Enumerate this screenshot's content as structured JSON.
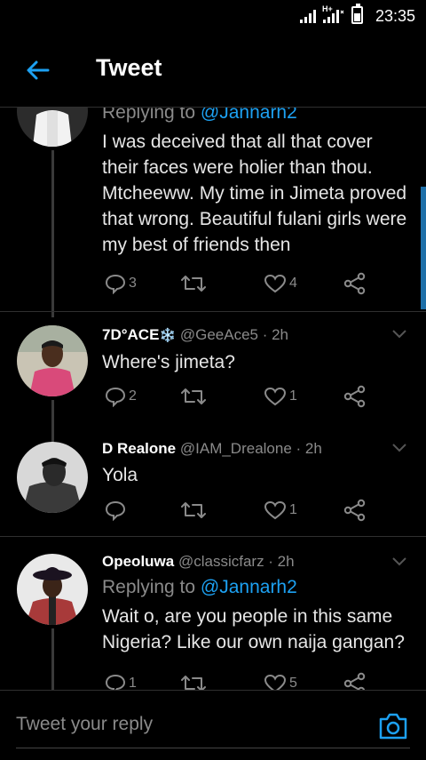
{
  "status_bar": {
    "time": "23:35",
    "network": "H+"
  },
  "header": {
    "title": "Tweet"
  },
  "tweets": [
    {
      "replying_label": "Replying to ",
      "replying_to": "@Jannarh2",
      "text": "I was deceived that all that cover their faces were holier than thou. Mtcheeww. My time in Jimeta proved that wrong. Beautiful fulani girls were my best of friends then",
      "replies": "3",
      "retweets": "",
      "likes": "4"
    },
    {
      "name": "7D°ACE",
      "name_emoji": "❄️",
      "handle": "@GeeAce5 · 2h",
      "text": "Where's jimeta?",
      "replies": "2",
      "retweets": "",
      "likes": "1"
    },
    {
      "name": "D Realone",
      "handle": "@IAM_Drealone · 2h",
      "text": "Yola",
      "replies": "",
      "retweets": "",
      "likes": "1"
    },
    {
      "name": "Opeoluwa",
      "handle": "@classicfarz · 2h",
      "replying_label": "Replying to ",
      "replying_to": "@Jannarh2",
      "text": "Wait o, are you people in this same Nigeria? Like our own naija gangan?",
      "replies": "1",
      "retweets": "",
      "likes": "5"
    }
  ],
  "reply_bar": {
    "placeholder": "Tweet your reply"
  },
  "colors": {
    "accent": "#1da1f2",
    "background": "#000000",
    "muted": "#8a8a8a"
  }
}
